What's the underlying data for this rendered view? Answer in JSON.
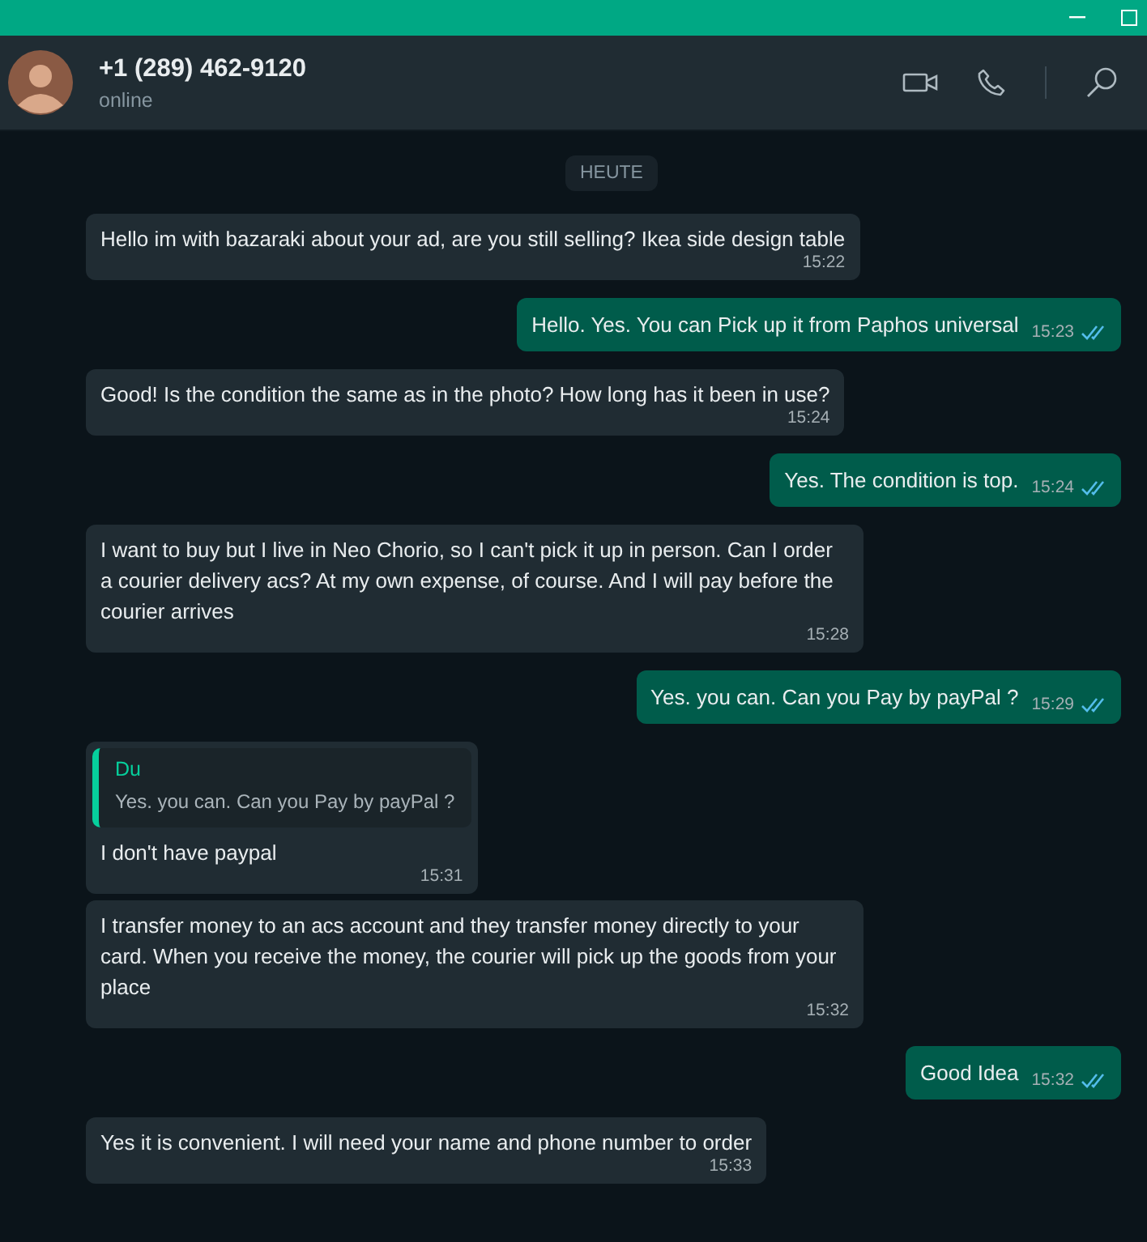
{
  "contact": {
    "name": "+1 (289) 462-9120",
    "status": "online"
  },
  "date_divider": "HEUTE",
  "messages": [
    {
      "kind": "incoming",
      "text": "Hello im with bazaraki about your ad, are you still selling? Ikea side design table",
      "time": "15:22"
    },
    {
      "kind": "outgoing",
      "text": "Hello. Yes. You can Pick up it from Paphos universal",
      "time": "15:23",
      "read": true
    },
    {
      "kind": "incoming",
      "text": "Good! Is the condition the same as in the photo? How long has it been in use?",
      "time": "15:24"
    },
    {
      "kind": "outgoing",
      "text": "Yes. The condition is top.",
      "time": "15:24",
      "read": true
    },
    {
      "kind": "incoming",
      "text": "I want to buy but I live in Neo Chorio, so I can't pick it up in person. Can I order a courier delivery acs? At my own expense, of course. And I will pay before the courier arrives",
      "time": "15:28"
    },
    {
      "kind": "outgoing",
      "text": "Yes. you can. Can you Pay by payPal ?",
      "time": "15:29",
      "read": true
    },
    {
      "kind": "incoming",
      "quote": {
        "author": "Du",
        "text": "Yes. you can. Can you Pay by payPal ?"
      },
      "text": "I don't have paypal",
      "time": "15:31"
    },
    {
      "kind": "incoming",
      "text": "I transfer money to an acs account and they transfer money directly to your card. When you receive the money, the courier will pick up the goods from your place",
      "time": "15:32"
    },
    {
      "kind": "outgoing",
      "text": "Good Idea",
      "time": "15:32",
      "read": true
    },
    {
      "kind": "incoming",
      "text": "Yes it is convenient. I will need your name and phone number to order",
      "time": "15:33"
    }
  ]
}
